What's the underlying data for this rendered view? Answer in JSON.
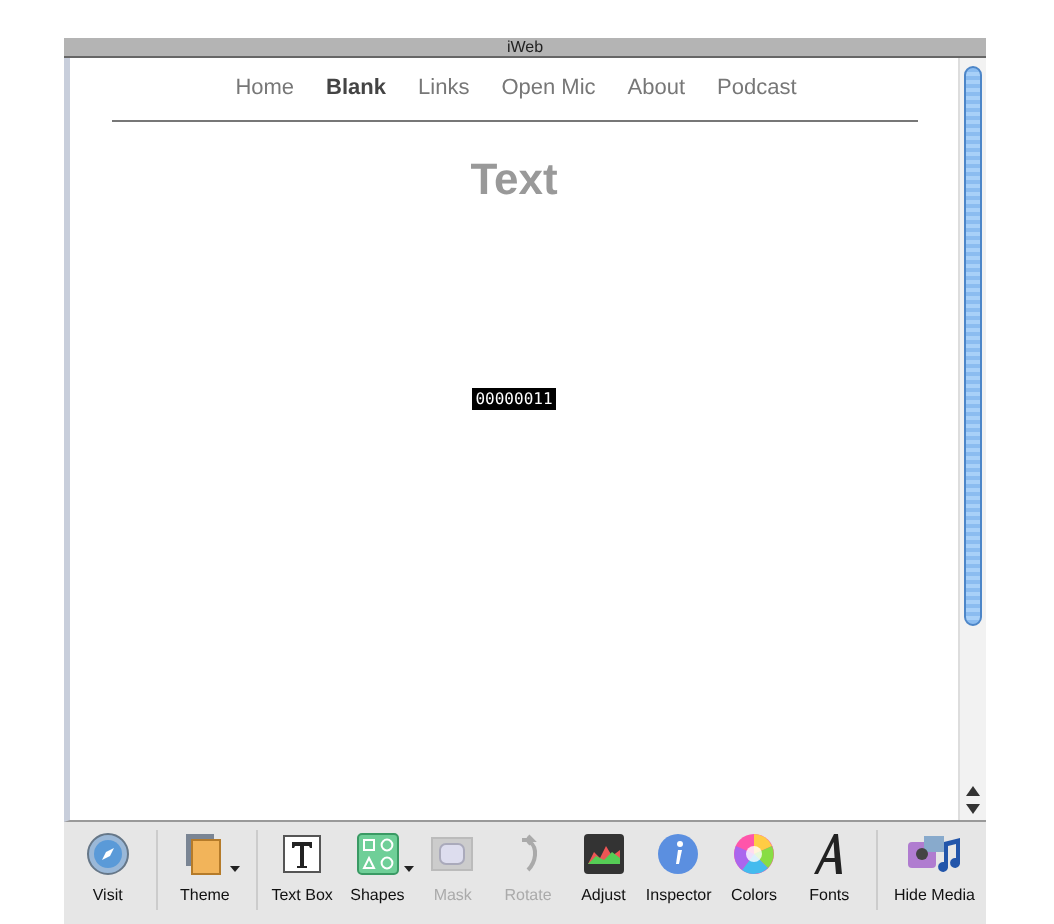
{
  "window": {
    "title": "iWeb"
  },
  "nav": [
    {
      "label": "Home",
      "selected": false
    },
    {
      "label": "Blank",
      "selected": true
    },
    {
      "label": "Links",
      "selected": false
    },
    {
      "label": "Open Mic",
      "selected": false
    },
    {
      "label": "About",
      "selected": false
    },
    {
      "label": "Podcast",
      "selected": false
    }
  ],
  "page": {
    "heading": "Text",
    "tag": "00000011"
  },
  "toolbar": [
    {
      "kind": "visit",
      "label": "Visit",
      "disabled": false,
      "menu": false
    },
    {
      "kind": "separator"
    },
    {
      "kind": "theme",
      "label": "Theme",
      "disabled": false,
      "menu": true
    },
    {
      "kind": "separator"
    },
    {
      "kind": "textbox",
      "label": "Text Box",
      "disabled": false,
      "menu": false
    },
    {
      "kind": "shapes",
      "label": "Shapes",
      "disabled": false,
      "menu": true
    },
    {
      "kind": "mask",
      "label": "Mask",
      "disabled": true,
      "menu": false
    },
    {
      "kind": "rotate",
      "label": "Rotate",
      "disabled": true,
      "menu": false
    },
    {
      "kind": "adjust",
      "label": "Adjust",
      "disabled": false,
      "menu": false
    },
    {
      "kind": "inspector",
      "label": "Inspector",
      "disabled": false,
      "menu": false
    },
    {
      "kind": "colors",
      "label": "Colors",
      "disabled": false,
      "menu": false
    },
    {
      "kind": "fonts",
      "label": "Fonts",
      "disabled": false,
      "menu": false
    },
    {
      "kind": "separator"
    },
    {
      "kind": "media",
      "label": "Hide Media",
      "disabled": false,
      "menu": false
    }
  ]
}
